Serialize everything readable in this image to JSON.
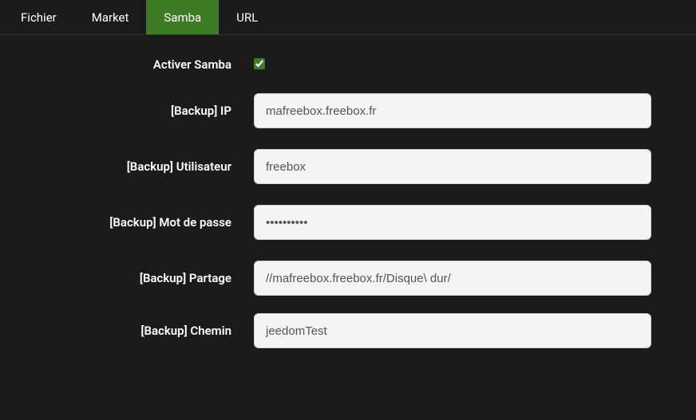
{
  "tabs": [
    {
      "label": "Fichier",
      "active": false
    },
    {
      "label": "Market",
      "active": false
    },
    {
      "label": "Samba",
      "active": true
    },
    {
      "label": "URL",
      "active": false
    }
  ],
  "form": {
    "activate_label": "Activer Samba",
    "activate_checked": true,
    "ip_label": "[Backup] IP",
    "ip_value": "mafreebox.freebox.fr",
    "user_label": "[Backup] Utilisateur",
    "user_value": "freebox",
    "password_label": "[Backup] Mot de passe",
    "password_value": "••••••••••",
    "share_label": "[Backup] Partage",
    "share_value": "//mafreebox.freebox.fr/Disque\\ dur/",
    "path_label": "[Backup] Chemin",
    "path_value": "jeedomTest"
  }
}
